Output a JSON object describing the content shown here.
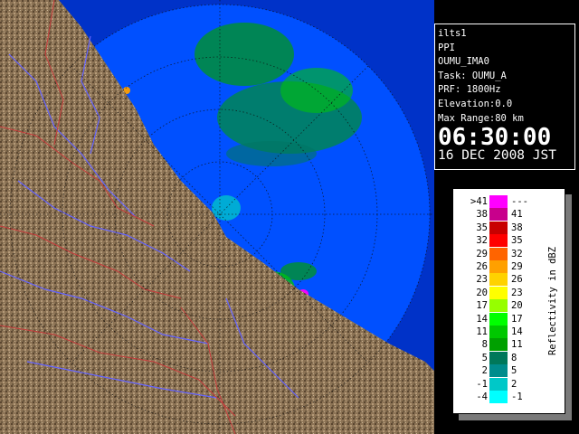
{
  "info": {
    "station": "ilts1",
    "product": "PPI",
    "site": "OUMU_IMA0",
    "task": "Task: OUMU_A",
    "prf": "PRF: 1800Hz",
    "elevation": "Elevation:0.0",
    "max_range": "Max Range:80 km",
    "time": "06:30:00",
    "date": "16 DEC 2008 JST"
  },
  "legend": {
    "unit": "Reflectivity in dBZ",
    "bins": [
      {
        "low": ">41",
        "high": "---",
        "color": "#ff00ff"
      },
      {
        "low": "38",
        "high": "41",
        "color": "#c8008c"
      },
      {
        "low": "35",
        "high": "38",
        "color": "#c80000"
      },
      {
        "low": "32",
        "high": "35",
        "color": "#ff0000"
      },
      {
        "low": "29",
        "high": "32",
        "color": "#ff6400"
      },
      {
        "low": "26",
        "high": "29",
        "color": "#ffa000"
      },
      {
        "low": "23",
        "high": "26",
        "color": "#ffd200"
      },
      {
        "low": "20",
        "high": "23",
        "color": "#ffff00"
      },
      {
        "low": "17",
        "high": "20",
        "color": "#96ff00"
      },
      {
        "low": "14",
        "high": "17",
        "color": "#00ff00"
      },
      {
        "low": "11",
        "high": "14",
        "color": "#00c800"
      },
      {
        "low": "8",
        "high": "11",
        "color": "#00a000"
      },
      {
        "low": "5",
        "high": "8",
        "color": "#00785a"
      },
      {
        "low": "2",
        "high": "5",
        "color": "#008c8c"
      },
      {
        "low": "-1",
        "high": "2",
        "color": "#00c8c8"
      },
      {
        "low": "-4",
        "high": "-1",
        "color": "#00ffff"
      }
    ]
  },
  "colors": {
    "coverage": "#0050ff",
    "outside": "#0032c8",
    "land": "#8c7355",
    "rivers": "#6464ff",
    "borders": "#c83c3c"
  }
}
